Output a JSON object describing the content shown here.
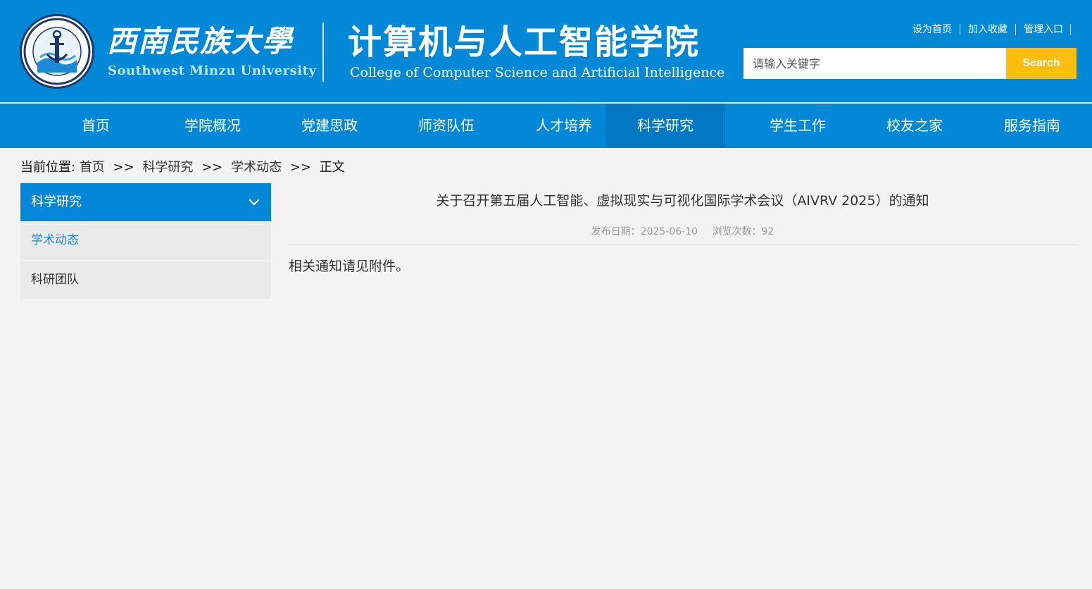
{
  "header": {
    "university_cn": "西南民族大學",
    "university_en": "Southwest Minzu University",
    "college_cn": "计算机与人工智能学院",
    "college_en": "College of Computer Science and Artificial Intelligence",
    "top_links": [
      "设为首页",
      "加入收藏",
      "管理入口"
    ],
    "search": {
      "placeholder": "请输入关键字",
      "button_label": "Search"
    },
    "colors": {
      "brand_blue": "#0288d6",
      "search_button": "#fbbe0e"
    }
  },
  "nav": {
    "items": [
      {
        "label": "首页"
      },
      {
        "label": "学院概况"
      },
      {
        "label": "党建思政"
      },
      {
        "label": "师资队伍"
      },
      {
        "label": "人才培养"
      },
      {
        "label": "科学研究",
        "active": true
      },
      {
        "label": "学生工作"
      },
      {
        "label": "校友之家"
      },
      {
        "label": "服务指南"
      }
    ]
  },
  "breadcrumb": {
    "prefix": "当前位置:",
    "items": [
      "首页",
      "科学研究",
      "学术动态",
      "正文"
    ],
    "separator": ">>"
  },
  "sidebar": {
    "title": "科学研究",
    "items": [
      {
        "label": "学术动态",
        "current": true
      },
      {
        "label": "科研团队",
        "current": false
      }
    ]
  },
  "article": {
    "title": "关于召开第五届人工智能、虚拟现实与可视化国际学术会议（AIVRV 2025）的通知",
    "publish_date": "发布日期：2025-06-10",
    "views": "浏览次数：92",
    "body": "相关通知请见附件。"
  }
}
